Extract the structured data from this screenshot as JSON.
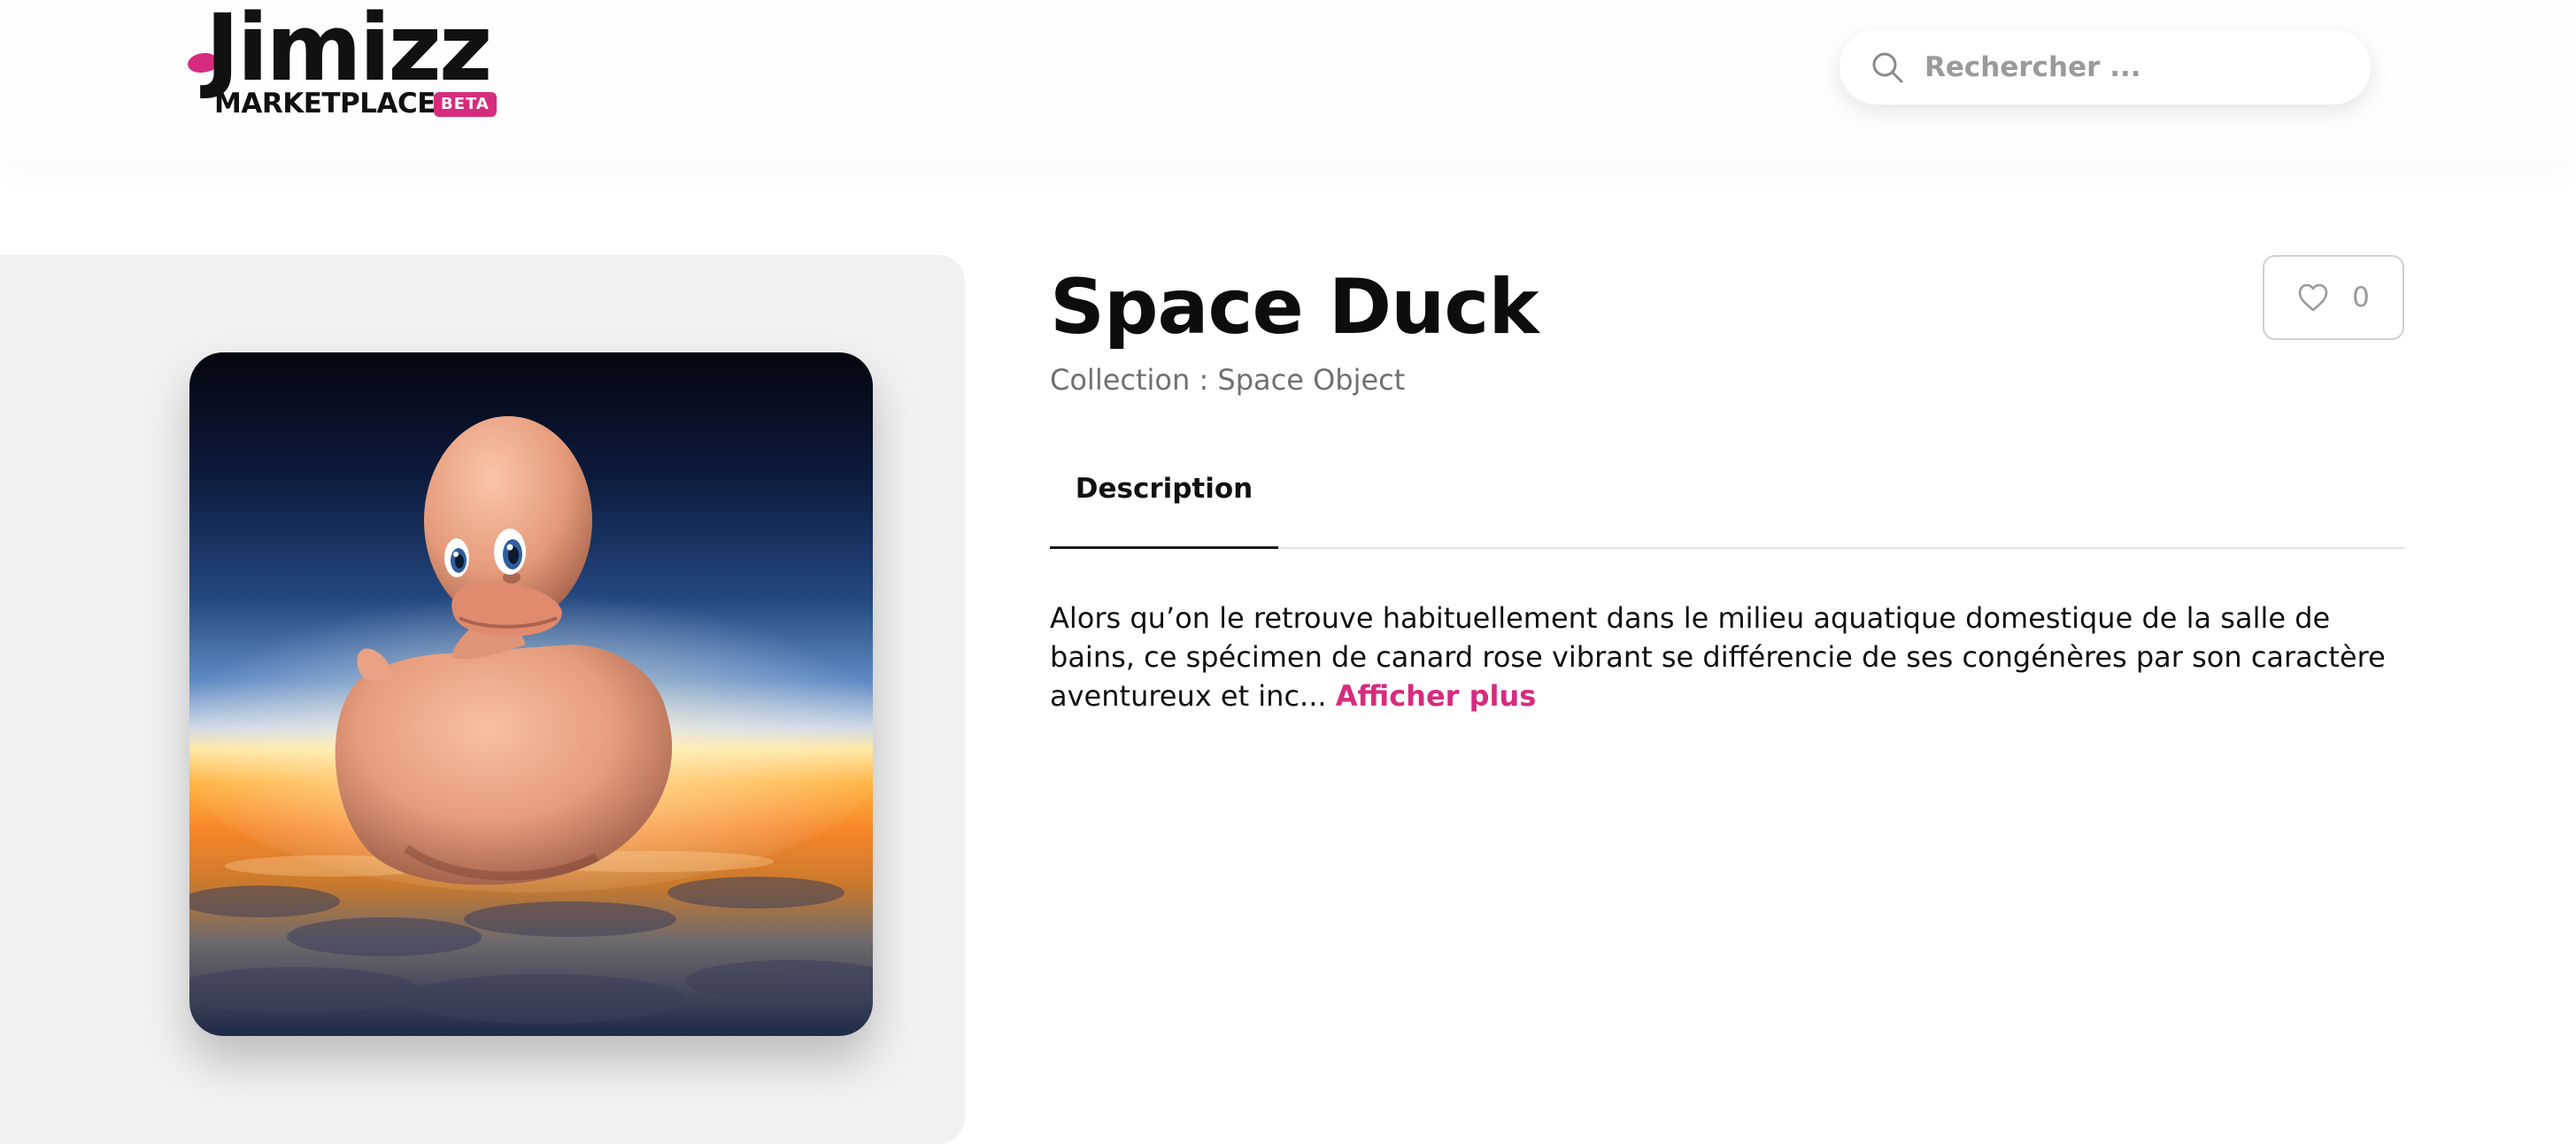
{
  "header": {
    "logo": {
      "wordmark": "Jimizz",
      "subtitle": "MARKETPLACE",
      "badge": "BETA"
    },
    "search": {
      "placeholder": "Rechercher ...",
      "value": "",
      "icon": "search-icon"
    }
  },
  "product": {
    "title": "Space Duck",
    "collection_label": "Collection : ",
    "collection_value": "Space Object",
    "likes": {
      "count": "0",
      "icon": "heart-outline-icon"
    },
    "tabs": [
      {
        "label": "Description",
        "active": true
      }
    ],
    "description": "Alors qu’on le retrouve habituellement dans le milieu aquatique domestique de la salle de bains, ce spécimen de canard rose vibrant se différencie de ses congénères par son caractère aventureux et inc...",
    "read_more": "Afficher plus"
  },
  "colors": {
    "accent": "#d72b7e",
    "text": "#111111",
    "muted": "#707070",
    "panel": "#f1f1f1",
    "border": "#cfcfcf"
  }
}
